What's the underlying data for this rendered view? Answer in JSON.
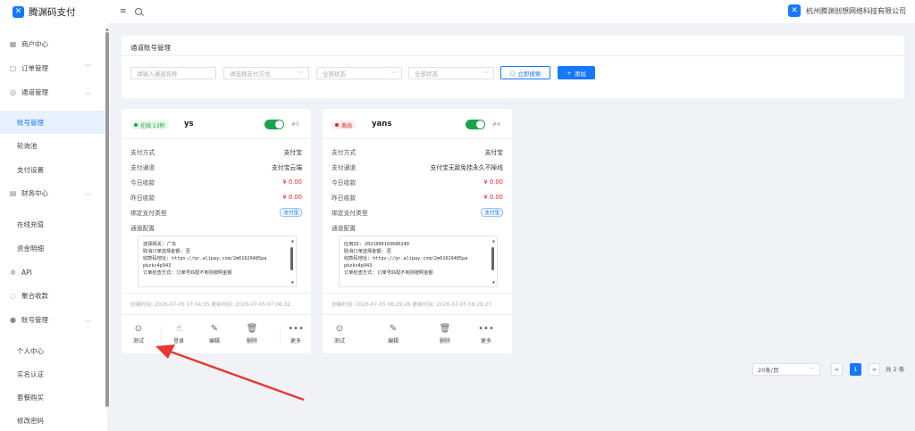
{
  "brand": {
    "name": "腾渊码支付"
  },
  "header": {
    "company": "杭州腾渊创想网络科技有限公司"
  },
  "sidebar": {
    "items": [
      {
        "label": "商户中心",
        "icon": "grid-icon"
      },
      {
        "label": "订单管理",
        "icon": "clipboard-icon"
      },
      {
        "label": "通道管理",
        "icon": "settings-icon"
      },
      {
        "label": "账号管理"
      },
      {
        "label": "轮询池"
      },
      {
        "label": "支付设置"
      },
      {
        "label": "财务中心",
        "icon": "finance-icon"
      },
      {
        "label": "在线充值"
      },
      {
        "label": "资金明细"
      },
      {
        "label": "API",
        "icon": "api-icon"
      },
      {
        "label": "聚合收款",
        "icon": "aggregate-icon"
      },
      {
        "label": "账号管理",
        "icon": "user-icon"
      },
      {
        "label": "个人中心"
      },
      {
        "label": "实名认证"
      },
      {
        "label": "套餐购买"
      },
      {
        "label": "修改密码"
      }
    ]
  },
  "filter": {
    "title": "通道账号管理",
    "name_placeholder": "请输入通道名称",
    "pay_method_placeholder": "请选择支付方式",
    "status1": "全部状态",
    "status2": "全部状态",
    "search_label": "立即搜索",
    "add_label": "添加"
  },
  "card_labels": {
    "pay_method": "支付方式",
    "pay_channel": "支付通道",
    "today": "今日收款",
    "yesterday": "昨日收款",
    "bind_type": "绑定支付类型",
    "config": "通道配置"
  },
  "cards": [
    {
      "status": "在线 13秒",
      "name": "ys",
      "id": "#5",
      "pay_method": "支付宝",
      "pay_channel": "支付宝云端",
      "today": "¥ 0.00",
      "yesterday": "¥ 0.00",
      "bind_type": "支付宝",
      "config": [
        "选择网关: 广东",
        "取消订单选择金额: 否",
        "收款码地址: https://qr.alipay.com/2m61620485pa",
        "pkzkc4p943",
        "订单检查方式: 订单号匹配不到则按照金额"
      ],
      "timestamps": "创建时间: 2026-07-05 07:04:35 更新时间: 2026-07-05 07:06:32",
      "actions": [
        "测试",
        "登录",
        "编辑",
        "删除",
        "更多"
      ]
    },
    {
      "status": "离线",
      "name": "yans",
      "id": "#4",
      "pay_method": "支付宝",
      "pay_channel": "支付宝无敌免挂永久不掉线",
      "today": "¥ 0.00",
      "yesterday": "¥ 0.00",
      "bind_type": "支付宝",
      "config": [
        "应用ID: 2021006169686240",
        "取消订单选择金额: 否",
        "收款码地址: https://qr.alipay.com/2m61620485pa",
        "pkzkc4p943",
        "订单检查方式: 订单号匹配不到则按照金额"
      ],
      "timestamps": "创建时间: 2026-07-05 06:29:26 更新时间: 2026-07-05 06:29:27",
      "actions": [
        "测试",
        "编辑",
        "删除",
        "更多"
      ]
    }
  ],
  "pagination": {
    "page_size": "20条/页",
    "prev": "<",
    "current": "1",
    "next": ">",
    "total": "共 2 条"
  },
  "colors": {
    "accent": "#1677ff",
    "online": "#1aa34a",
    "offline": "#e02b2b",
    "annotation": "#e53935"
  }
}
